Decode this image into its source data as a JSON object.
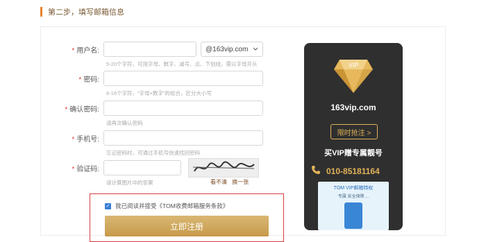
{
  "step": {
    "title": "第二步，填写邮箱信息"
  },
  "form": {
    "username": {
      "label": "用户名:",
      "domain": "@163vip.com",
      "hint": "5-20个字符，可用字母、数字、减号、点、下划线，需以字母开头"
    },
    "password": {
      "label": "密码:",
      "hint": "6-16个字符，“字母+数字”的组合，区分大小写"
    },
    "confirm": {
      "label": "确认密码:",
      "hint": "请再次确认密码"
    },
    "phone": {
      "label": "手机号:",
      "hint": "忘记密码时，可通过手机号快速找回密码"
    },
    "captcha": {
      "label": "验证码:",
      "hint": "请计算图片中的答案",
      "unclear": "看不清",
      "refresh": "换一张"
    },
    "agree_text": "我已阅读并接受《TOM收费邮箱服务条款》",
    "register_label": "立即注册"
  },
  "vip": {
    "badge": "VIP",
    "domain": "163vip.com",
    "cta": "限时抢注 >",
    "slogan": "买VIP赠专属靓号",
    "phone": "010-85181164",
    "ad_title": "TOM VIP邮箱特权",
    "ad_sub": "专属 安全保障 ..."
  },
  "colors": {
    "accent": "#e8812b",
    "vip_gold": "#e2b25a",
    "register": "#c79a4a",
    "highlight_border": "#d73c3c"
  }
}
